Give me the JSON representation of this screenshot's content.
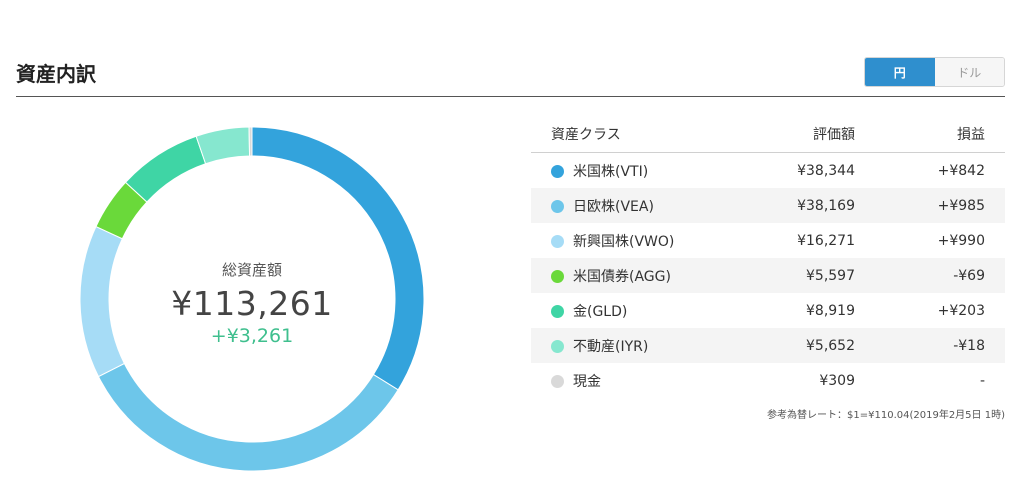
{
  "header": {
    "title": "資産内訳",
    "currency_options": [
      {
        "label": "円",
        "active": true
      },
      {
        "label": "ドル",
        "active": false
      }
    ]
  },
  "summary": {
    "label": "総資産額",
    "total": "¥113,261",
    "gain": "+¥3,261"
  },
  "table": {
    "headers": [
      "資産クラス",
      "評価額",
      "損益"
    ],
    "rows": [
      {
        "name": "米国株(VTI)",
        "color": "#33a3dc",
        "value": "¥38,344",
        "pl": "+¥842",
        "pl_type": "pos"
      },
      {
        "name": "日欧株(VEA)",
        "color": "#6dc6ea",
        "value": "¥38,169",
        "pl": "+¥985",
        "pl_type": "pos"
      },
      {
        "name": "新興国株(VWO)",
        "color": "#a6dcf6",
        "value": "¥16,271",
        "pl": "+¥990",
        "pl_type": "pos"
      },
      {
        "name": "米国債券(AGG)",
        "color": "#6ad93a",
        "value": "¥5,597",
        "pl": "-¥69",
        "pl_type": "neg"
      },
      {
        "name": "金(GLD)",
        "color": "#3fd5a5",
        "value": "¥8,919",
        "pl": "+¥203",
        "pl_type": "pos"
      },
      {
        "name": "不動産(IYR)",
        "color": "#86e7cf",
        "value": "¥5,652",
        "pl": "-¥18",
        "pl_type": "neg"
      },
      {
        "name": "現金",
        "color": "#d9d9d9",
        "value": "¥309",
        "pl": "-",
        "pl_type": "neu"
      }
    ]
  },
  "note": "参考為替レート：$1=¥110.04(2019年2月5日 1時)",
  "chart_data": {
    "type": "pie",
    "categories": [
      "米国株(VTI)",
      "日欧株(VEA)",
      "新興国株(VWO)",
      "米国債券(AGG)",
      "金(GLD)",
      "不動産(IYR)",
      "現金"
    ],
    "values": [
      38344,
      38169,
      16271,
      5597,
      8919,
      5652,
      309
    ],
    "colors": [
      "#33a3dc",
      "#6dc6ea",
      "#a6dcf6",
      "#6ad93a",
      "#3fd5a5",
      "#86e7cf",
      "#d9d9d9"
    ],
    "title": "",
    "donut": true
  }
}
